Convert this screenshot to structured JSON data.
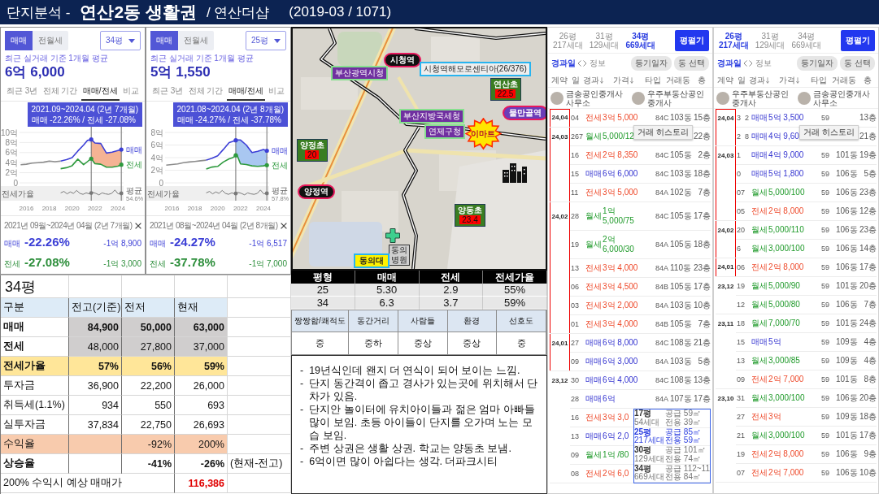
{
  "title": {
    "section": "단지분석 -",
    "area": "연산2동 생활권",
    "complex": "/ 연산더샵",
    "info": "(2019-03 / 1071)"
  },
  "apps": [
    {
      "modes": [
        {
          "label": "매매",
          "selected": true
        },
        {
          "label": "전월세",
          "selected": false
        }
      ],
      "size": "34평",
      "caption": "최근 실거래 기준 1개월 평균",
      "price": "6억 6,000",
      "tabs": [
        {
          "label": "최근 3년",
          "selected": false
        },
        {
          "label": "전체 기간",
          "selected": false
        },
        {
          "label": "매매/전세",
          "selected": true
        },
        {
          "label": "비교",
          "selected": false
        }
      ],
      "tooltip": [
        "2021.09~2024.04 (2년 7개월)",
        "매매 -22.26% / 전세 -27.08%"
      ],
      "color": "#f5b394",
      "chart_data": {
        "type": "line",
        "x": [
          2015.5,
          2016,
          2016.5,
          2017,
          2017.5,
          2018,
          2018.5,
          2019,
          2019.5,
          2020,
          2020.5,
          2021,
          2021.33,
          2021.67,
          2022,
          2022.5,
          2023,
          2023.5,
          2024,
          2024.3
        ],
        "series": [
          {
            "color": "#8c8c8c",
            "values": [
              3.6,
              3.7,
              3.9,
              4.0,
              4.1,
              4.3,
              4.2,
              4.3,
              null,
              null,
              null,
              null,
              null,
              null,
              null,
              null,
              null,
              null,
              null,
              null
            ]
          },
          {
            "name": "매매",
            "color": "#3c3fd6",
            "values": [
              null,
              null,
              null,
              null,
              null,
              null,
              null,
              4.3,
              4.6,
              5.0,
              6.3,
              7.5,
              8.4,
              8.6,
              7.9,
              7.8,
              5.9,
              6.1,
              6.4,
              6.6
            ]
          },
          {
            "name": "전세",
            "color": "#2e9a3e",
            "values": [
              null,
              null,
              null,
              null,
              null,
              null,
              null,
              2.8,
              3.0,
              3.4,
              4.7,
              3.6,
              4.2,
              4.8,
              3.8,
              3.7,
              3.1,
              3.1,
              3.3,
              3.6
            ]
          }
        ],
        "xlim": [
          2015.4,
          2024.5
        ],
        "ylim": [
          0,
          10
        ],
        "xticks": [
          2016,
          2018,
          2020,
          2022,
          2024
        ],
        "yticks": [
          {
            "value": 0,
            "label": "0"
          },
          {
            "value": 2,
            "label": "2억"
          },
          {
            "value": 4,
            "label": "4억"
          },
          {
            "value": 6,
            "label": "6억"
          },
          {
            "value": 8,
            "label": "8억"
          },
          {
            "value": 10,
            "label": "10억"
          }
        ],
        "grid": true,
        "ref_lines": [
          {
            "axis": "x",
            "value": 2021.67
          },
          {
            "axis": "x",
            "value": 2024.3
          }
        ]
      },
      "ratio_label": "전세가율",
      "ratio_average": [
        "평균",
        "54.6%"
      ],
      "period": "2021년 09월~2024년 04월 (2년 7개월)",
      "stats": [
        {
          "kind": "sale",
          "label": "매매",
          "change": "-22.26%",
          "amount": "-1억 8,900"
        },
        {
          "kind": "jeonse",
          "label": "전세",
          "change": "-27.08%",
          "amount": "-1억 3,000"
        }
      ]
    },
    {
      "modes": [
        {
          "label": "매매",
          "selected": true
        },
        {
          "label": "전월세",
          "selected": false
        }
      ],
      "size": "25평",
      "caption": "최근 실거래 기준 1개월 평균",
      "price": "5억 1,550",
      "tabs": [
        {
          "label": "최근 3년",
          "selected": false
        },
        {
          "label": "전체 기간",
          "selected": false
        },
        {
          "label": "매매/전세",
          "selected": true
        },
        {
          "label": "비교",
          "selected": false
        }
      ],
      "tooltip": [
        "2021.08~2024.04 (2년 8개월)",
        "매매 -24.27% / 전세 -37.78%"
      ],
      "color": "#a9c7f1",
      "chart_data": {
        "type": "line",
        "x": [
          2015.5,
          2016,
          2016.5,
          2017,
          2017.5,
          2018,
          2018.5,
          2019,
          2019.5,
          2020,
          2020.5,
          2021,
          2021.33,
          2021.67,
          2022,
          2022.5,
          2023,
          2023.5,
          2024,
          2024.3
        ],
        "series": [
          {
            "color": "#8c8c8c",
            "values": [
              2.8,
              2.9,
              3.0,
              3.2,
              3.3,
              3.4,
              3.5,
              3.6,
              null,
              null,
              null,
              null,
              null,
              null,
              null,
              null,
              null,
              null,
              null,
              null
            ]
          },
          {
            "name": "매매",
            "color": "#3c3fd6",
            "values": [
              null,
              null,
              null,
              null,
              null,
              null,
              null,
              3.6,
              3.9,
              4.3,
              5.3,
              6.4,
              6.6,
              6.8,
              6.8,
              6.0,
              4.8,
              5.0,
              5.3,
              5.1
            ]
          },
          {
            "name": "전세",
            "color": "#2e9a3e",
            "values": [
              null,
              null,
              null,
              null,
              null,
              null,
              null,
              2.2,
              2.5,
              2.6,
              3.3,
              3.8,
              4.0,
              4.5,
              3.0,
              2.9,
              2.7,
              2.6,
              2.7,
              2.8
            ]
          }
        ],
        "xlim": [
          2015.4,
          2024.5
        ],
        "ylim": [
          0,
          8
        ],
        "xticks": [
          2016,
          2018,
          2020,
          2022,
          2024
        ],
        "yticks": [
          {
            "value": 0,
            "label": "0"
          },
          {
            "value": 2,
            "label": "2억"
          },
          {
            "value": 4,
            "label": "4억"
          },
          {
            "value": 6,
            "label": "6억"
          },
          {
            "value": 8,
            "label": "8억"
          }
        ],
        "grid": true,
        "ref_lines": [
          {
            "axis": "x",
            "value": 2021.58
          },
          {
            "axis": "x",
            "value": 2024.3
          }
        ]
      },
      "ratio_label": "전세가율",
      "ratio_average": [
        "평균",
        "57.8%"
      ],
      "period": "2021년 08월~2024년 04월 (2년 8개월)",
      "stats": [
        {
          "kind": "sale",
          "label": "매매",
          "change": "-24.27%",
          "amount": "-1억 6,517"
        },
        {
          "kind": "jeonse",
          "label": "전세",
          "change": "-37.78%",
          "amount": "-1억 7,000"
        }
      ]
    }
  ],
  "price_table": {
    "title": "34평",
    "columns": [
      "구분",
      "전고(기준)",
      "전저",
      "현재"
    ],
    "rows": [
      {
        "kind": "sale",
        "label": "매매",
        "peak": "84,900",
        "low": "50,000",
        "now": "63,000"
      },
      {
        "kind": "lease",
        "label": "전세",
        "peak": "48,000",
        "low": "27,800",
        "now": "37,000"
      },
      {
        "kind": "ratio",
        "label": "전세가율",
        "peak": "57%",
        "low": "56%",
        "now": "59%"
      },
      {
        "kind": "plain",
        "label": "투자금",
        "peak": "36,900",
        "low": "22,200",
        "now": "26,000"
      },
      {
        "kind": "plain",
        "label": "취득세(1.1%)",
        "peak": "934",
        "low": "550",
        "now": "693"
      },
      {
        "kind": "plain",
        "label": "실투자금",
        "peak": "37,834",
        "low": "22,750",
        "now": "26,693"
      },
      {
        "kind": "yield",
        "label": "수익율",
        "low": "-92%",
        "now": "200%"
      },
      {
        "kind": "growth",
        "label": "상승율",
        "low": "-41%",
        "now": "-26%",
        "note": "(현재-전고)"
      }
    ],
    "footer": {
      "label": "200% 수익시 예상 매매가",
      "value": "116,386"
    }
  },
  "map": {
    "markers": [
      {
        "kind": "station",
        "label": "시청역",
        "color": "#111111"
      },
      {
        "kind": "office",
        "label": "부산광역시청"
      },
      {
        "kind": "complex",
        "label": "시청역해모로센티아(26/376)"
      },
      {
        "kind": "school",
        "label": "연산초",
        "score": "22.5"
      },
      {
        "kind": "office",
        "label": "부산지방국세청"
      },
      {
        "kind": "station",
        "label": "물만골역",
        "color": "#6b3db8"
      },
      {
        "kind": "office",
        "label": "연제구청"
      },
      {
        "kind": "mart",
        "label": "이마트"
      },
      {
        "kind": "school",
        "label": "양정초",
        "score": "20"
      },
      {
        "kind": "buildings"
      },
      {
        "kind": "station",
        "label": "양정역",
        "color": "#111111"
      },
      {
        "kind": "school",
        "label": "양동초",
        "score": "23.4"
      },
      {
        "kind": "cross"
      },
      {
        "kind": "hospital",
        "label": "동의 병원"
      },
      {
        "kind": "university",
        "label": "동의대"
      }
    ]
  },
  "size_table": {
    "columns": [
      "평형",
      "매매",
      "전세",
      "전세가율"
    ],
    "rows": [
      [
        "25",
        "5.30",
        "2.9",
        "55%"
      ],
      [
        "34",
        "6.3",
        "3.7",
        "59%"
      ]
    ]
  },
  "ratings": {
    "columns": [
      "짱짱함/쾌적도",
      "동간거리",
      "사람들",
      "환경",
      "선호도"
    ],
    "values": [
      "중",
      "중하",
      "중상",
      "중상",
      "중"
    ]
  },
  "notes": [
    {
      "mark": "-",
      "text": "19년식인데 왠지 더 연식이 되어 보이는 느낌."
    },
    {
      "mark": "-",
      "text": "단지 동간격이 좁고 경사가 있는곳에 위치해서 단차가 있음."
    },
    {
      "mark": "-",
      "text": "단지안 놀이터에 유치아이들과 젊은 엄마 아빠들 많이 보임. 초등 아이들이 단지를 오가며 노는 모습 보임."
    },
    {
      "mark": "-",
      "text": "주변 상권은 생활 상권. 학교는 양동초 보냄."
    },
    {
      "mark": "-",
      "text": "6억이면 많이 아쉽다는 생각. 더파크시티"
    }
  ],
  "deals": [
    {
      "sizes": [
        {
          "label": "26평",
          "count": "217세대",
          "selected": false
        },
        {
          "label": "31평",
          "count": "129세대",
          "selected": false
        },
        {
          "label": "34평",
          "count": "669세대",
          "selected": true
        }
      ],
      "button": "평펼기",
      "sort": "경과일",
      "info": "정보",
      "filters": [
        "등기일자",
        "동 선택"
      ],
      "columns": [
        {
          "label": "계약",
          "sortable": false
        },
        {
          "label": "일",
          "sortable": false
        },
        {
          "label": "경과",
          "sortable": true
        },
        {
          "label": "가격",
          "sortable": true
        },
        {
          "label": "타입",
          "sortable": false
        },
        {
          "label": "거래동",
          "sortable": false
        },
        {
          "label": "층",
          "sortable": false
        }
      ],
      "agents": [
        "금송공인중개사사무소",
        "우주부동산공인중개사"
      ],
      "highlighted_rows": [
        {
          "month": "24,04",
          "day": "04",
          "kind": "jeonse",
          "deal": "전세",
          "price": "3억 5,000",
          "type": "84C",
          "dong": "103동",
          "floor": "15층"
        },
        {
          "month": "24,03",
          "day": "26",
          "elapsed": "7",
          "kind": "monthly",
          "deal": "월세",
          "price": "5,000/12",
          "floor": "22층"
        },
        {
          "day": "16",
          "kind": "jeonse",
          "deal": "전세",
          "price": "2억 8,350",
          "type": "84C",
          "dong": "105동",
          "floor": "2층"
        },
        {
          "day": "15",
          "kind": "sale",
          "deal": "매매",
          "price": "6억 6,000",
          "type": "84C",
          "dong": "103동",
          "floor": "18층"
        },
        {
          "day": "11",
          "kind": "jeonse",
          "deal": "전세",
          "price": "3억 5,000",
          "type": "84A",
          "dong": "102동",
          "floor": "7층"
        },
        {
          "month": "24,02",
          "day": "28",
          "kind": "monthly",
          "deal": "월세",
          "price": "1억 5,000/75",
          "type": "84C",
          "dong": "105동",
          "floor": "17층"
        },
        {
          "day": "19",
          "kind": "monthly",
          "deal": "월세",
          "price": "2억 6,000/30",
          "type": "84A",
          "dong": "105동",
          "floor": "18층"
        },
        {
          "day": "13",
          "kind": "jeonse",
          "deal": "전세",
          "price": "3억 4,000",
          "type": "84A",
          "dong": "110동",
          "floor": "23층"
        },
        {
          "day": "06",
          "kind": "jeonse",
          "deal": "전세",
          "price": "3억 4,500",
          "type": "84B",
          "dong": "105동",
          "floor": "17층"
        },
        {
          "day": "03",
          "kind": "jeonse",
          "deal": "전세",
          "price": "3억 2,000",
          "type": "84A",
          "dong": "103동",
          "floor": "10층"
        },
        {
          "day": "01",
          "kind": "jeonse",
          "deal": "전세",
          "price": "3억 4,000",
          "type": "84B",
          "dong": "105동",
          "floor": "7층"
        },
        {
          "month": "24,01",
          "day": "27",
          "kind": "sale",
          "deal": "매매",
          "price": "6억 8,000",
          "type": "84C",
          "dong": "108동",
          "floor": "21층"
        },
        {
          "day": "09",
          "kind": "sale",
          "deal": "매매",
          "price": "6억 3,000",
          "type": "84A",
          "dong": "103동",
          "floor": "5층"
        }
      ],
      "rows": [
        {
          "month": "23,12",
          "day": "30",
          "kind": "sale",
          "deal": "매매",
          "price": "6억 4,000",
          "type": "84C",
          "dong": "108동",
          "floor": "13층"
        },
        {
          "day": "28",
          "kind": "sale",
          "deal": "매매",
          "price": "6억",
          "type": "84A",
          "dong": "107동",
          "floor": "17층"
        },
        {
          "day": "16",
          "kind": "jeonse",
          "deal": "전세",
          "price": "3억 3,0"
        },
        {
          "day": "13",
          "kind": "sale",
          "deal": "매매",
          "price": "6억 2,0"
        },
        {
          "day": "09",
          "kind": "monthly",
          "deal": "월세",
          "price": "1억 /80"
        },
        {
          "day": "08",
          "kind": "jeonse",
          "deal": "전세",
          "price": "2억 6,0"
        }
      ],
      "tooltip": "거래 히스토리",
      "popup": [
        {
          "size": "17평",
          "count": "54세대",
          "supply": "공급 59㎡",
          "exclusive": "전용 39㎡",
          "selected": false
        },
        {
          "size": "25평",
          "count": "217세대",
          "supply": "공급 85㎡",
          "exclusive": "전용 59㎡",
          "selected": true
        },
        {
          "size": "30평",
          "count": "129세대",
          "supply": "공급 101㎡",
          "exclusive": "전용 74㎡",
          "selected": false
        },
        {
          "size": "34평",
          "count": "669세대",
          "supply": "공급 112~11",
          "exclusive": "전용 84㎡",
          "selected": false
        }
      ]
    },
    {
      "sizes": [
        {
          "label": "26평",
          "count": "217세대",
          "selected": true
        },
        {
          "label": "31평",
          "count": "129세대",
          "selected": false
        },
        {
          "label": "34평",
          "count": "669세대",
          "selected": false
        }
      ],
      "button": "평펼기",
      "sort": "경과일",
      "info": "정보",
      "filters": [
        "등기일자",
        "동 선택"
      ],
      "columns": [
        {
          "label": "계약",
          "sortable": false
        },
        {
          "label": "일",
          "sortable": false
        },
        {
          "label": "경과",
          "sortable": true
        },
        {
          "label": "가격",
          "sortable": true
        },
        {
          "label": "타입",
          "sortable": false
        },
        {
          "label": "거래동",
          "sortable": false
        },
        {
          "label": "층",
          "sortable": false
        }
      ],
      "agents": [
        "우주부동산공인중개사",
        "금송공인중개사사무소"
      ],
      "highlighted_rows": [
        {
          "month": "24,04",
          "day": "3",
          "elapsed": "2",
          "kind": "sale",
          "deal": "매매",
          "price": "5억 3,500",
          "type": "59",
          "floor": "13층"
        },
        {
          "day": "2",
          "elapsed": "8",
          "kind": "sale",
          "deal": "매매",
          "price": "4억 9,60",
          "floor": "21층"
        },
        {
          "month": "24,03",
          "day": "1",
          "kind": "sale",
          "deal": "매매",
          "price": "4억 9,000",
          "type": "59",
          "dong": "101동",
          "floor": "19층"
        },
        {
          "day": "0",
          "kind": "sale",
          "deal": "매매",
          "price": "5억 1,800",
          "type": "59",
          "dong": "106동",
          "floor": "5층"
        },
        {
          "day": "07",
          "kind": "monthly",
          "deal": "월세",
          "price": "5,000/100",
          "type": "59",
          "dong": "106동",
          "floor": "23층"
        },
        {
          "day": "05",
          "kind": "jeonse",
          "deal": "전세",
          "price": "2억 8,000",
          "type": "59",
          "dong": "106동",
          "floor": "12층"
        },
        {
          "month": "24,02",
          "day": "20",
          "kind": "monthly",
          "deal": "월세",
          "price": "5,000/110",
          "type": "59",
          "dong": "106동",
          "floor": "23층"
        },
        {
          "day": "6",
          "kind": "monthly",
          "deal": "월세",
          "price": "3,000/100",
          "type": "59",
          "dong": "106동",
          "floor": "14층"
        },
        {
          "month": "24,01",
          "day": "06",
          "kind": "jeonse",
          "deal": "전세",
          "price": "2억 8,000",
          "type": "59",
          "dong": "106동",
          "floor": "17층"
        }
      ],
      "rows": [
        {
          "month": "23,12",
          "day": "19",
          "kind": "monthly",
          "deal": "월세",
          "price": "5,000/90",
          "type": "59",
          "dong": "101동",
          "floor": "20층"
        },
        {
          "day": "12",
          "kind": "monthly",
          "deal": "월세",
          "price": "5,000/80",
          "type": "59",
          "dong": "106동",
          "floor": "7층"
        },
        {
          "month": "23,11",
          "day": "18",
          "kind": "monthly",
          "deal": "월세",
          "price": "7,000/70",
          "type": "59",
          "dong": "101동",
          "floor": "24층"
        },
        {
          "day": "15",
          "kind": "sale",
          "deal": "매매",
          "price": "5억",
          "type": "59",
          "dong": "109동",
          "floor": "4층"
        },
        {
          "day": "13",
          "kind": "monthly",
          "deal": "월세",
          "price": "3,000/85",
          "type": "59",
          "dong": "109동",
          "floor": "4층"
        },
        {
          "day": "09",
          "kind": "jeonse",
          "deal": "전세",
          "price": "2억 7,000",
          "type": "59",
          "dong": "101동",
          "floor": "8층"
        },
        {
          "month": "23,10",
          "day": "31",
          "kind": "monthly",
          "deal": "월세",
          "price": "3,000/100",
          "type": "59",
          "dong": "106동",
          "floor": "20층"
        },
        {
          "day": "27",
          "kind": "jeonse",
          "deal": "전세",
          "price": "3억",
          "type": "59",
          "dong": "109동",
          "floor": "18층"
        },
        {
          "day": "21",
          "kind": "monthly",
          "deal": "월세",
          "price": "3,000/100",
          "type": "59",
          "dong": "101동",
          "floor": "17층"
        },
        {
          "day": "19",
          "kind": "jeonse",
          "deal": "전세",
          "price": "2억 8,000",
          "type": "59",
          "dong": "106동",
          "floor": "9층"
        },
        {
          "day": "07",
          "kind": "jeonse",
          "deal": "전세",
          "price": "2억 7,000",
          "type": "59",
          "dong": "106동",
          "floor": "10층"
        }
      ],
      "tooltip": "거래 히스토리"
    }
  ]
}
